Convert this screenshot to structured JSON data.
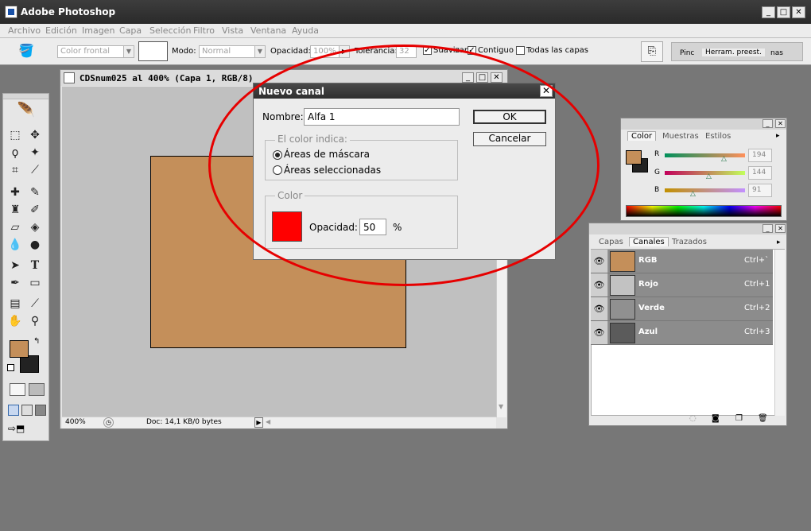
{
  "app": {
    "title": "Adobe Photoshop"
  },
  "window_buttons": {
    "minimize": "_",
    "maximize": "□",
    "close": "✕"
  },
  "menu": [
    "Archivo",
    "Edición",
    "Imagen",
    "Capa",
    "Selección",
    "Filtro",
    "Vista",
    "Ventana",
    "Ayuda"
  ],
  "options_bar": {
    "fill_source": "Color frontal",
    "mode_label": "Modo:",
    "mode_value": "Normal",
    "opacity_label": "Opacidad:",
    "opacity_value": "100%",
    "tolerance_label": "Tolerancia:",
    "tolerance_value": "32",
    "antialias_label": "Suavizar",
    "contiguous_label": "Contiguo",
    "all_layers_label": "Todas las capas",
    "palette_well": [
      "Pinc",
      "Herram. preest.",
      "nas"
    ]
  },
  "document": {
    "title": "CDSnum025 al 400% (Capa 1, RGB/8)",
    "zoom": "400%",
    "doc_info": "Doc: 14,1 KB/0 bytes",
    "fill_color": "#c48f5a"
  },
  "dialog": {
    "title": "Nuevo canal",
    "name_label": "Nombre:",
    "name_value": "Alfa 1",
    "ok_label": "OK",
    "cancel_label": "Cancelar",
    "color_indicates_legend": "El color indica:",
    "option_masked": "Áreas de máscara",
    "option_selected": "Áreas seleccionadas",
    "selected_option": "option_masked",
    "color_legend": "Color",
    "swatch_color": "#ff0000",
    "opacity_label": "Opacidad:",
    "opacity_value": "50",
    "opacity_unit": "%"
  },
  "color_panel": {
    "tabs": [
      "Color",
      "Muestras",
      "Estilos"
    ],
    "active_tab": "Color",
    "channels": [
      {
        "label": "R",
        "value": "194"
      },
      {
        "label": "G",
        "value": "144"
      },
      {
        "label": "B",
        "value": "91"
      }
    ],
    "foreground": "#c48f5a",
    "background": "#222222"
  },
  "channels_panel": {
    "tabs": [
      "Capas",
      "Canales",
      "Trazados"
    ],
    "active_tab": "Canales",
    "rows": [
      {
        "name": "RGB",
        "shortcut": "Ctrl+`",
        "thumb": "#c48f5a"
      },
      {
        "name": "Rojo",
        "shortcut": "Ctrl+1",
        "thumb": "#c2c2c2"
      },
      {
        "name": "Verde",
        "shortcut": "Ctrl+2",
        "thumb": "#909090"
      },
      {
        "name": "Azul",
        "shortcut": "Ctrl+3",
        "thumb": "#5b5b5b"
      }
    ]
  }
}
